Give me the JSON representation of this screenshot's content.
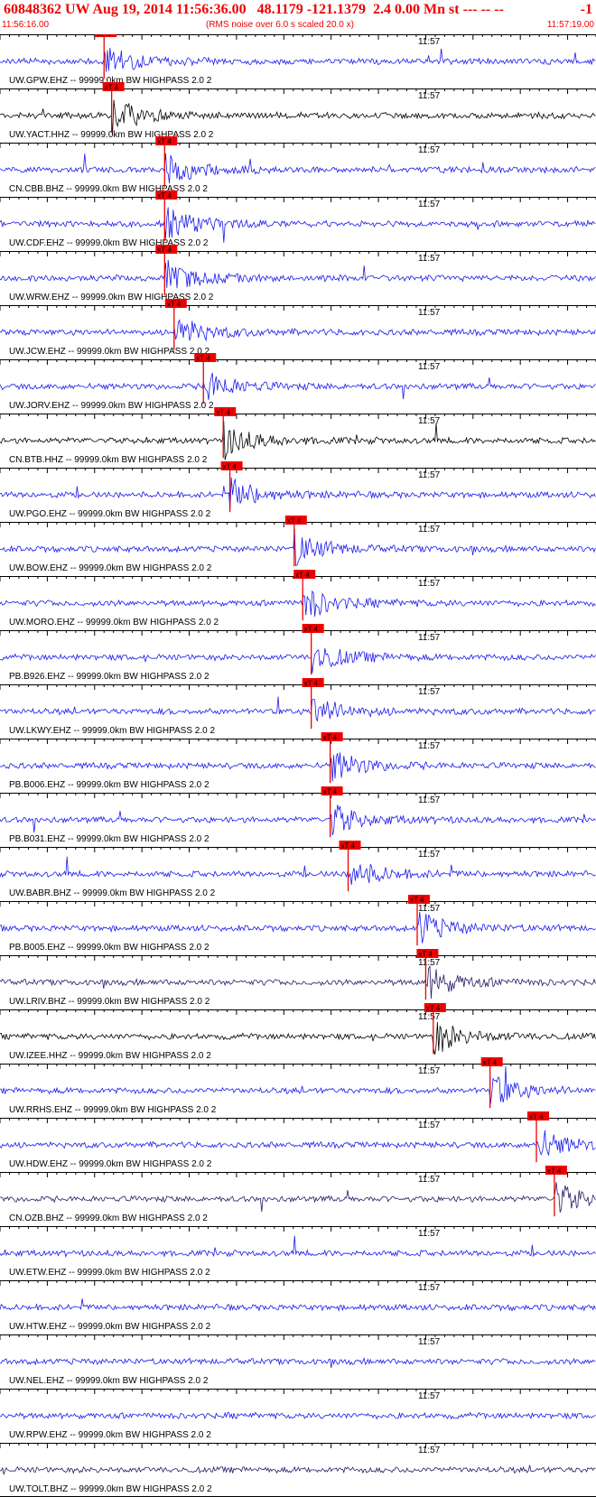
{
  "header": {
    "title": "60848362 UW Aug 19, 2014 11:56:36.00   48.1179 -121.1379  2.4 0.00 Mn st --- -- --",
    "title_right": "-1",
    "start_time": "11:56:16.00",
    "note": "(RMS noise over 6.0 s scaled 20.0 x)",
    "end_time": "11:57:19.00"
  },
  "colors": {
    "header_text": "#ee0000",
    "pick_marker": "#ee0000",
    "axis": "#000000"
  },
  "chart_data": {
    "type": "line",
    "title": "60848362 UW Aug 19, 2014 11:56:36.00   48.1179 -121.1379  2.4 0.00 Mn st --- -- --   -1",
    "x_range_seconds": [
      0,
      63
    ],
    "x_start": "11:56:16.00",
    "x_end": "11:57:19.00",
    "tick_label": "11:57",
    "tick_label_second": 44,
    "pick_label": "xT 4",
    "series": [
      {
        "name": "UW.GPW.EHZ -- 99999.0km BW  HIGHPASS  2.0  2",
        "color": "#1a1aee",
        "pick_s": 11.0
      },
      {
        "name": "UW.YACT.HHZ -- 99999.0km BW  HIGHPASS  2.0  2",
        "color": "#000000",
        "pick_s": 11.8
      },
      {
        "name": "CN.CBB.BHZ -- 99999.0km BW  HIGHPASS  2.0  2",
        "color": "#1a1aee",
        "pick_s": 17.4
      },
      {
        "name": "UW.CDF.EHZ -- 99999.0km BW  HIGHPASS  2.0  2",
        "color": "#1a1aee",
        "pick_s": 17.4
      },
      {
        "name": "UW.WRW.EHZ -- 99999.0km BW  HIGHPASS  2.0  2",
        "color": "#1a1aee",
        "pick_s": 17.4
      },
      {
        "name": "UW.JCW.EHZ -- 99999.0km BW  HIGHPASS  2.0  2",
        "color": "#1a1aee",
        "pick_s": 18.4
      },
      {
        "name": "UW.JORV.EHZ -- 99999.0km BW  HIGHPASS  2.0  2",
        "color": "#1a1aee",
        "pick_s": 21.5
      },
      {
        "name": "CN.BTB.HHZ -- 99999.0km BW  HIGHPASS  2.0  2",
        "color": "#000000",
        "pick_s": 23.6
      },
      {
        "name": "UW.PGO.EHZ -- 99999.0km BW  HIGHPASS  2.0  2",
        "color": "#1a1aee",
        "pick_s": 24.3
      },
      {
        "name": "UW.BOW.EHZ -- 99999.0km BW  HIGHPASS  2.0  2",
        "color": "#1a1aee",
        "pick_s": 31.1
      },
      {
        "name": "UW.MORO.EHZ -- 99999.0km BW  HIGHPASS  2.0  2",
        "color": "#1a1aee",
        "pick_s": 32.0
      },
      {
        "name": "PB.B926.EHZ -- 99999.0km BW  HIGHPASS  2.0  2",
        "color": "#1a1aee",
        "pick_s": 32.9
      },
      {
        "name": "UW.LKWY.EHZ -- 99999.0km BW  HIGHPASS  2.0  2",
        "color": "#1a1aee",
        "pick_s": 32.9
      },
      {
        "name": "PB.B006.EHZ -- 99999.0km BW  HIGHPASS  2.0  2",
        "color": "#1a1aee",
        "pick_s": 34.9
      },
      {
        "name": "PB.B031.EHZ -- 99999.0km BW  HIGHPASS  2.0  2",
        "color": "#1a1aee",
        "pick_s": 34.9
      },
      {
        "name": "UW.BABR.BHZ -- 99999.0km BW  HIGHPASS  2.0  2",
        "color": "#1a1aee",
        "pick_s": 36.8
      },
      {
        "name": "PB.B005.EHZ -- 99999.0km BW  HIGHPASS  2.0  2",
        "color": "#1a1aee",
        "pick_s": 44.1
      },
      {
        "name": "UW.LRIV.BHZ -- 99999.0km BW  HIGHPASS  2.0  2",
        "color": "#2a1a66",
        "pick_s": 45.0
      },
      {
        "name": "UW.IZEE.HHZ -- 99999.0km BW  HIGHPASS  2.0  2",
        "color": "#000000",
        "pick_s": 45.8
      },
      {
        "name": "UW.RRHS.EHZ -- 99999.0km BW  HIGHPASS  2.0  2",
        "color": "#1a1aee",
        "pick_s": 51.8
      },
      {
        "name": "UW.HDW.EHZ -- 99999.0km BW  HIGHPASS  2.0  2",
        "color": "#1a1aee",
        "pick_s": 56.7
      },
      {
        "name": "CN.OZB.BHZ -- 99999.0km BW  HIGHPASS  2.0  2",
        "color": "#2a1a66",
        "pick_s": 58.6
      },
      {
        "name": "UW.ETW.EHZ -- 99999.0km BW  HIGHPASS  2.0  2",
        "color": "#1a1aee",
        "pick_s": null
      },
      {
        "name": "UW.HTW.EHZ -- 99999.0km BW  HIGHPASS  2.0  2",
        "color": "#1a1aee",
        "pick_s": null
      },
      {
        "name": "UW.NEL.EHZ -- 99999.0km BW  HIGHPASS  2.0  2",
        "color": "#1a1aee",
        "pick_s": null
      },
      {
        "name": "UW.RPW.EHZ -- 99999.0km BW  HIGHPASS  2.0  2",
        "color": "#1a1aee",
        "pick_s": null
      },
      {
        "name": "UW.TOLT.BHZ -- 99999.0km BW  HIGHPASS  2.0  2",
        "color": "#2a1a66",
        "pick_s": null
      }
    ]
  }
}
